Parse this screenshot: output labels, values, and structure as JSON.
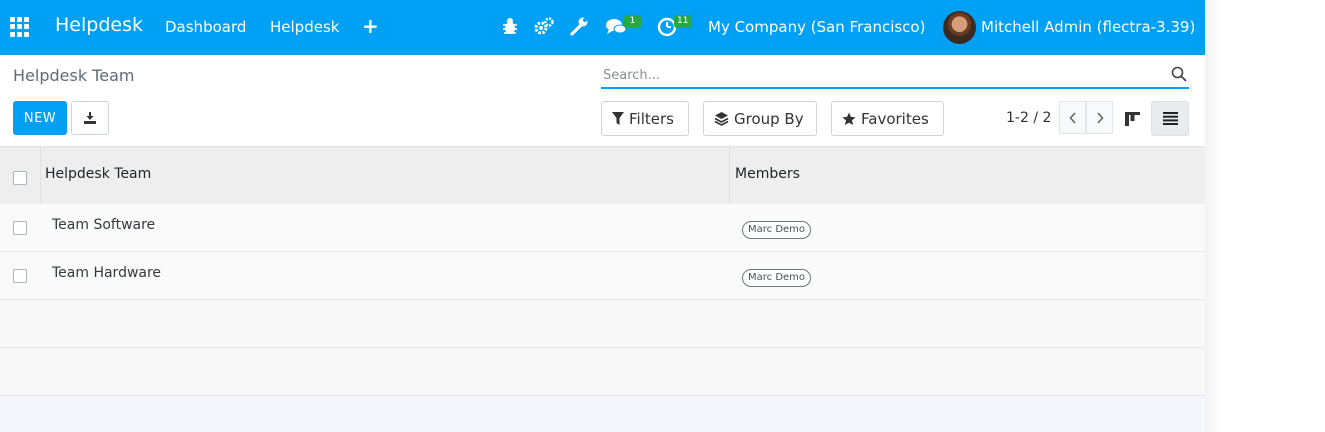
{
  "navbar": {
    "brand": "Helpdesk",
    "links": [
      "Dashboard",
      "Helpdesk"
    ],
    "add_label": "+",
    "icons": [
      "apps-icon",
      "bug-icon",
      "gears-icon",
      "wrench-icon",
      "chat-icon",
      "clock-icon",
      "plus-icon"
    ],
    "chat_badge": "1",
    "activity_badge": "11",
    "company": "My Company (San Francisco)",
    "user": "Mitchell Admin (flectra-3.39)",
    "accent_color": "#00a0f5",
    "badge_color": "#28a745"
  },
  "control_panel": {
    "breadcrumb": "Helpdesk Team",
    "search_placeholder": "Search...",
    "new_label": "NEW",
    "filters_label": "Filters",
    "groupby_label": "Group By",
    "favorites_label": "Favorites",
    "pager": "1-2 / 2"
  },
  "table": {
    "columns": [
      "Helpdesk Team",
      "Members"
    ],
    "rows": [
      {
        "name": "Team Software",
        "member": "Marc Demo"
      },
      {
        "name": "Team Hardware",
        "member": "Marc Demo"
      }
    ]
  }
}
